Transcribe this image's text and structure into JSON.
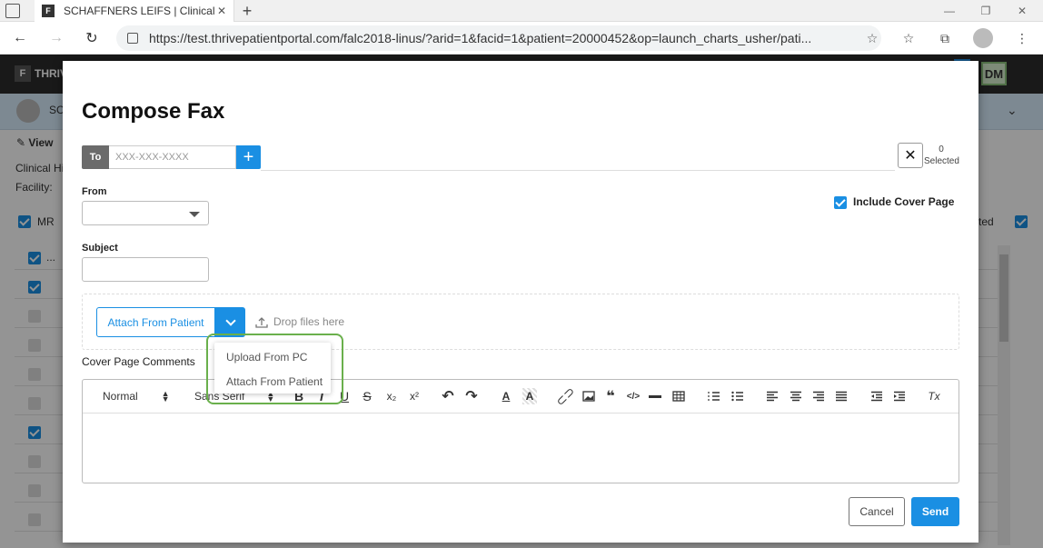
{
  "browser": {
    "tab_title": "SCHAFFNERS LEIFS | Clinical His",
    "tab_close": "✕",
    "new_tab": "+",
    "favicon": "F",
    "url": "https://test.thrivepatientportal.com/falc2018-linus/?arid=1&facid=1&patient=20000452&op=launch_charts_usher/pati..."
  },
  "app": {
    "brand": "THRIV",
    "user_initials": "DM",
    "patient_name": "SC",
    "view_label": "View",
    "clinical_label": "Clinical Hi",
    "facility_label": "Facility:",
    "mr_label": "MR",
    "selected_fragment": "ted",
    "row_dots": "..."
  },
  "modal": {
    "title": "Compose Fax",
    "to": {
      "label": "To",
      "placeholder": "XXX-XXX-XXXX",
      "add_symbol": "+"
    },
    "clear_symbol": "✕",
    "selected_count": "0",
    "selected_label": "Selected",
    "from_label": "From",
    "subject_label": "Subject",
    "include_cover_page": "Include Cover Page",
    "attach_button": "Attach From Patient",
    "drop_text": "Drop files here",
    "attach_menu": [
      "Upload From PC",
      "Attach From Patient"
    ],
    "cover_page_comments_label": "Cover Page Comments",
    "editor_toolbar": {
      "format": "Normal",
      "font": "Sans Serif",
      "bold": "B",
      "italic": "I",
      "underline": "U",
      "strike": "S",
      "subscript": "x₂",
      "superscript": "x²",
      "undo": "↶",
      "redo": "↷",
      "blockquote": "❝",
      "code": "</>",
      "clear_format": "Tx"
    },
    "cancel_label": "Cancel",
    "send_label": "Send"
  },
  "colors": {
    "primary": "#1a8fe3",
    "highlight": "#6ab04c",
    "to_label_bg": "#6b6b6b"
  }
}
